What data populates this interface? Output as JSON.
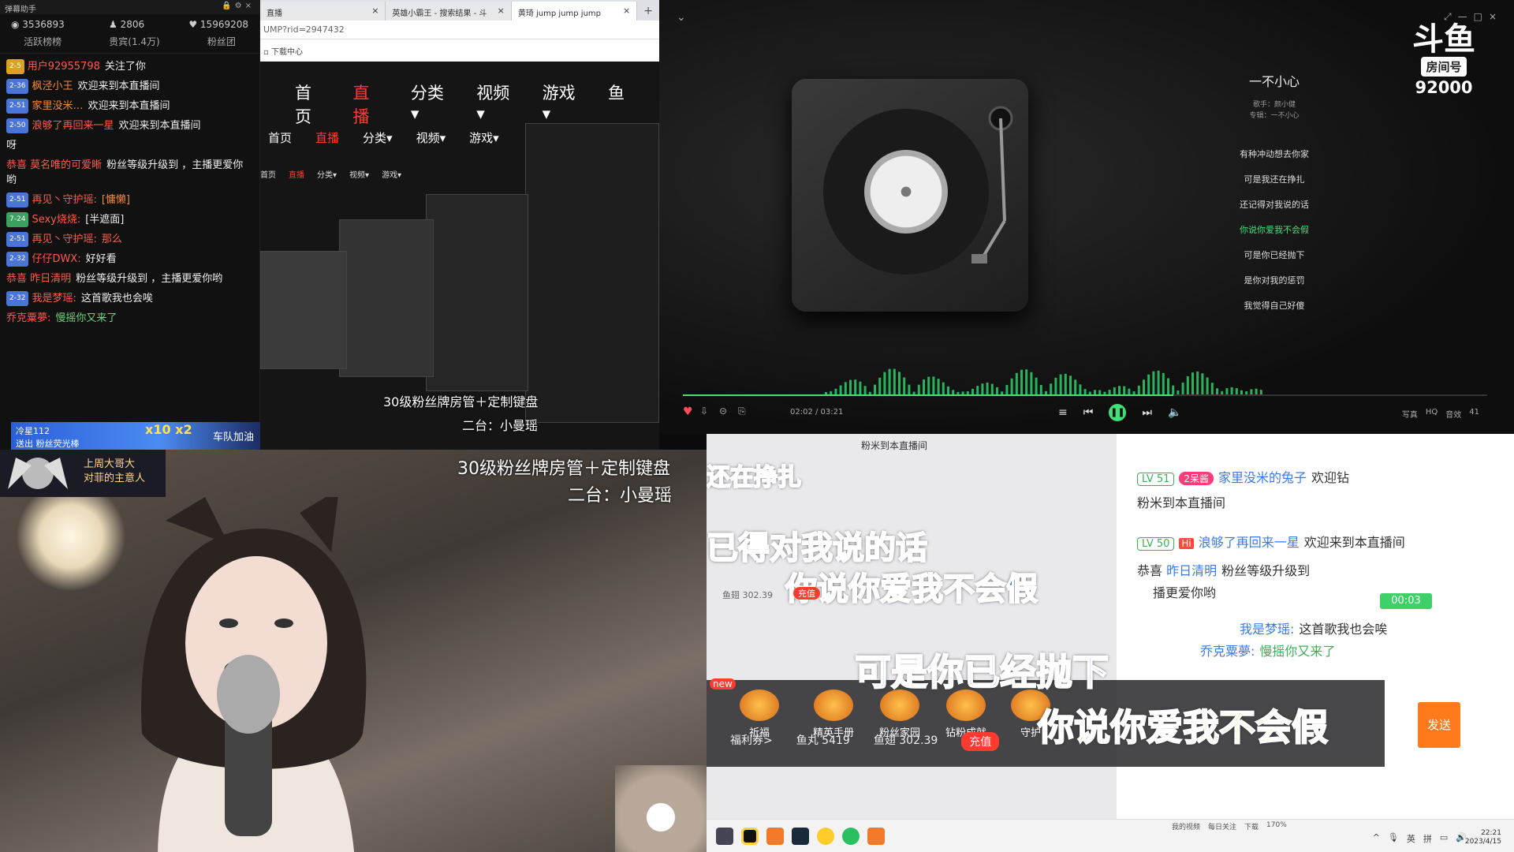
{
  "danmu": {
    "title": "弹幕助手",
    "stats": [
      "3536893",
      "2806",
      "15969208"
    ],
    "tabs": [
      "活跃榜榜",
      "贵宾(1.4万)",
      "粉丝团"
    ],
    "messages": [
      {
        "lv": "2-5",
        "name": "用户92955798",
        "text": "关注了你"
      },
      {
        "lv": "2-36",
        "name": "枫泾小王",
        "text": "欢迎来到本直播间"
      },
      {
        "lv": "2-51",
        "name": "家里没米…",
        "text": "欢迎来到本直播间"
      },
      {
        "lv": "2-50",
        "name": "浪够了再回来一星",
        "text": "欢迎来到本直播间"
      },
      {
        "lv": "",
        "name": "",
        "text": "呀"
      },
      {
        "lv": "",
        "name": "恭喜 莫名唯的可爱晰",
        "text": "粉丝等级升级到  ，主播更爱你哟"
      },
      {
        "lv": "2-51",
        "name": "再见丶守护瑶:",
        "text": "[慵懒]"
      },
      {
        "lv": "7-24",
        "name": "Sexy烧烧:",
        "text": "[半遮面]"
      },
      {
        "lv": "2-51",
        "name": "再见丶守护瑶:",
        "text": "那么"
      },
      {
        "lv": "2-32",
        "name": "仔仔DWX:",
        "text": "好好看"
      },
      {
        "lv": "",
        "name": "恭喜 昨日清明",
        "text": "粉丝等级升级到  ，主播更爱你哟"
      },
      {
        "lv": "2-32",
        "name": "我是梦瑶:",
        "text": "这首歌我也会唉"
      },
      {
        "lv": "",
        "name": "乔克粟夢:",
        "text": "慢摇你又来了"
      }
    ],
    "bottom_user": "冷星112",
    "bottom_note": "送出 粉丝荧光棒",
    "gift_count": "x10 x2",
    "bottom_team": "车队加油"
  },
  "browser": {
    "tabs": [
      {
        "label": "直播"
      },
      {
        "label": "英雄小霸王 - 搜索结果 - 斗"
      },
      {
        "label": "黄琦 jump jump jump"
      }
    ],
    "url": "UMP?rid=2947432",
    "bookmark": "下载中心",
    "nav": [
      "首页",
      "直播",
      "分类▾",
      "视频▾",
      "游戏▾",
      "鱼"
    ],
    "subtitle1": "30级粉丝牌房管＋定制键盘",
    "subtitle2": "二台：小曼瑶"
  },
  "player": {
    "title": "一不小心",
    "singer": "歌手：颜小健",
    "album": "专辑：一不小心",
    "lyrics": [
      "有种冲动想去你家",
      "可是我还在挣扎",
      "还记得对我说的话",
      "你说你爱我不会假",
      "可是你已经抛下",
      "是你对我的惩罚",
      "我觉得自己好傻"
    ],
    "current_lyric_index": 3,
    "time": "02:02 / 03:21",
    "progress": 0.61,
    "logo_text": "斗鱼",
    "room_label": "房间号",
    "room_number": "92000",
    "right_controls": [
      "写真",
      "HQ",
      "音效",
      "41"
    ]
  },
  "cam": {
    "caption1": "30级粉丝牌房管＋定制键盘",
    "caption2": "二台：小曼瑶",
    "avatar_text1": "上周大哥大",
    "avatar_text2": "对菲的主意人"
  },
  "chat": {
    "welcome_line": "粉米到本直播间",
    "line1_lv": "LV 51",
    "line1_name": "家里没米的兔子",
    "line1_text": "欢迎钻",
    "line1b": "粉米到本直播间",
    "line2_lv": "LV 50",
    "line2_name": "浪够了再回来一星",
    "line2_text": "欢迎来到本直播间",
    "line3_pre": "恭喜",
    "line3_name": "昨日清明",
    "line3_text": "粉丝等级升级到",
    "line3b": "播更爱你哟",
    "line4_name": "我是梦瑶:",
    "line4_text": "这首歌我也会唉",
    "line5_name": "乔克粟夢:",
    "line5_text": "慢摇你又来了",
    "timer": "00:03",
    "big1": "可是你已经抛下",
    "big2": "你说你爱我不会假",
    "mid1": "还在挣扎",
    "mid2": "已得对我说的话",
    "mid3": "你说你爱我不会假",
    "send": "发送",
    "new_tag": "new",
    "tools": [
      "祈福",
      "精英手册",
      "粉丝家园",
      "钻粉成就",
      "守护"
    ],
    "fuli": "福利券>",
    "yuwan": "鱼丸 5419",
    "yuchi": "鱼翅 302.39",
    "recharge": "充值",
    "small_yuchi": "鱼翅 302.39",
    "small_recharge": "充值",
    "gift_label": "2呆酱"
  },
  "taskbar": {
    "status": [
      "我的视频",
      "每日关注",
      "下载",
      "170%"
    ],
    "tray": [
      "英",
      "拼"
    ],
    "time": "22:21",
    "date": "2023/4/15"
  }
}
